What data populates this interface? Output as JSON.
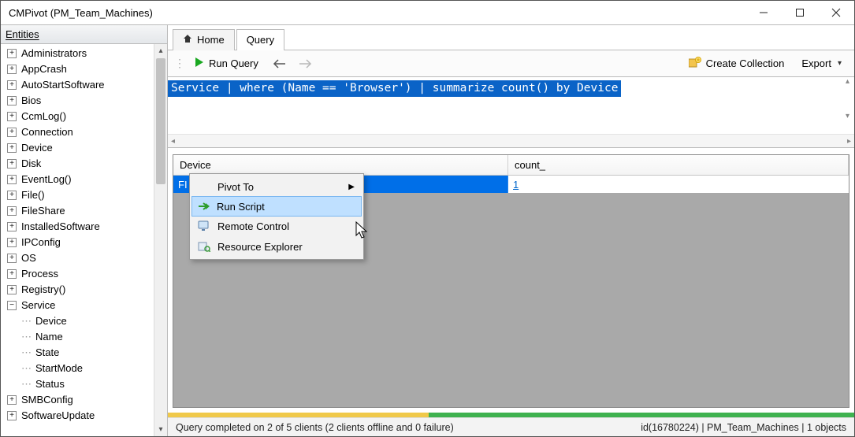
{
  "window": {
    "title": "CMPivot (PM_Team_Machines)"
  },
  "sidebar": {
    "header": "Entities",
    "items": [
      {
        "label": "Administrators",
        "expandable": true,
        "state": "+"
      },
      {
        "label": "AppCrash",
        "expandable": true,
        "state": "+"
      },
      {
        "label": "AutoStartSoftware",
        "expandable": true,
        "state": "+"
      },
      {
        "label": "Bios",
        "expandable": true,
        "state": "+"
      },
      {
        "label": "CcmLog()",
        "expandable": true,
        "state": "+"
      },
      {
        "label": "Connection",
        "expandable": true,
        "state": "+"
      },
      {
        "label": "Device",
        "expandable": true,
        "state": "+"
      },
      {
        "label": "Disk",
        "expandable": true,
        "state": "+"
      },
      {
        "label": "EventLog()",
        "expandable": true,
        "state": "+"
      },
      {
        "label": "File()",
        "expandable": true,
        "state": "+"
      },
      {
        "label": "FileShare",
        "expandable": true,
        "state": "+"
      },
      {
        "label": "InstalledSoftware",
        "expandable": true,
        "state": "+"
      },
      {
        "label": "IPConfig",
        "expandable": true,
        "state": "+"
      },
      {
        "label": "OS",
        "expandable": true,
        "state": "+"
      },
      {
        "label": "Process",
        "expandable": true,
        "state": "+"
      },
      {
        "label": "Registry()",
        "expandable": true,
        "state": "+"
      },
      {
        "label": "Service",
        "expandable": true,
        "state": "−",
        "children": [
          {
            "label": "Device"
          },
          {
            "label": "Name"
          },
          {
            "label": "State"
          },
          {
            "label": "StartMode"
          },
          {
            "label": "Status"
          }
        ]
      },
      {
        "label": "SMBConfig",
        "expandable": true,
        "state": "+"
      },
      {
        "label": "SoftwareUpdate",
        "expandable": true,
        "state": "+"
      }
    ]
  },
  "tabs": {
    "home": "Home",
    "query": "Query"
  },
  "toolbar": {
    "run": "Run Query",
    "create_collection": "Create Collection",
    "export": "Export"
  },
  "query": {
    "text": "Service | where (Name == 'Browser') | summarize count() by Device"
  },
  "grid": {
    "columns": {
      "c0": "Device",
      "c1": "count_"
    },
    "row": {
      "device_truncated": "FI",
      "count": "1"
    }
  },
  "context_menu": {
    "pivot": "Pivot To",
    "run_script": "Run Script",
    "remote_control": "Remote Control",
    "resource_explorer": "Resource Explorer"
  },
  "status": {
    "left": "Query completed on 2 of 5 clients (2 clients offline and 0 failure)",
    "right": "id(16780224)  |  PM_Team_Machines  |  1 objects"
  }
}
